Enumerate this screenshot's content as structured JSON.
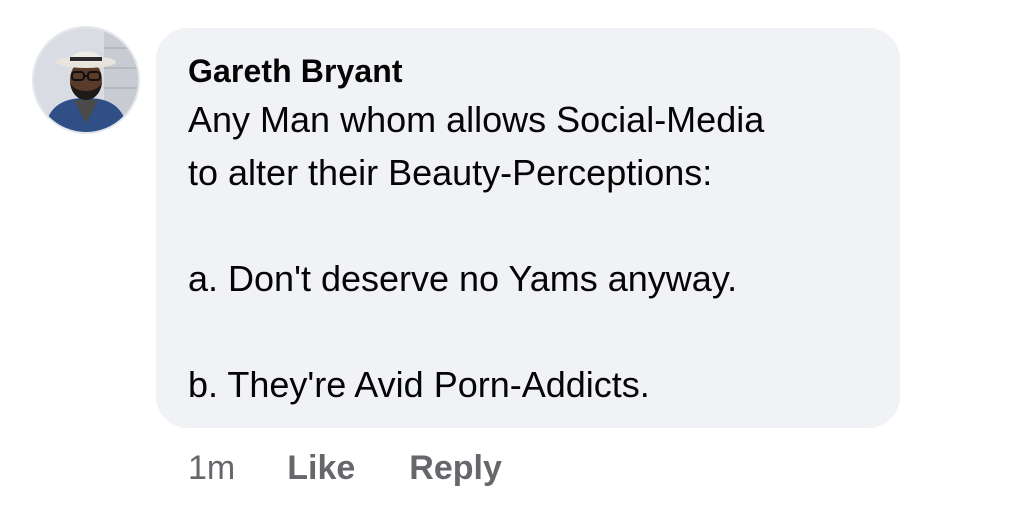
{
  "comment": {
    "author": "Gareth Bryant",
    "lines": [
      "Any Man whom allows Social-Media",
      "to alter their Beauty-Perceptions:",
      "",
      "a. Don't deserve no Yams anyway.",
      "",
      "b. They're Avid Porn-Addicts."
    ],
    "timestamp": "1m",
    "like_label": "Like",
    "reply_label": "Reply"
  },
  "colors": {
    "bubble_background": "#f0f2f5",
    "text": "#050505",
    "secondary_text": "#65676b"
  },
  "icons": {
    "avatar": "user-profile-photo"
  }
}
